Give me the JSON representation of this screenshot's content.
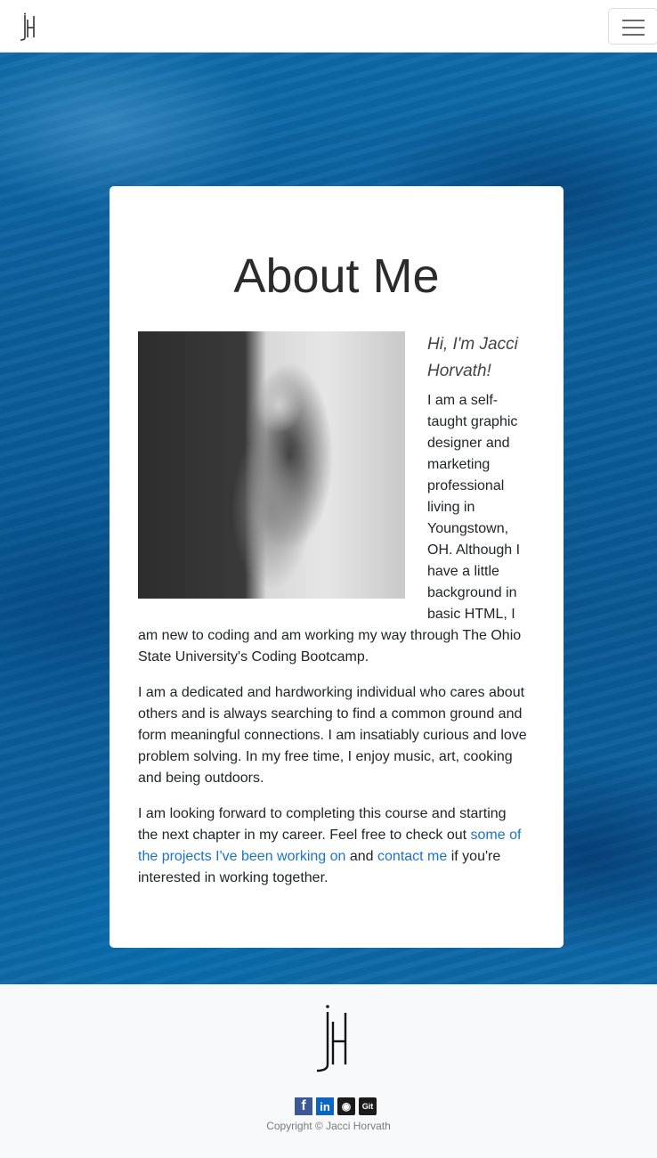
{
  "nav": {
    "logo_text": "jH",
    "menu_toggle_label": "Toggle navigation"
  },
  "about": {
    "title": "About Me",
    "greeting": "Hi, I'm Jacci Horvath!",
    "para1": "I am a self-taught graphic designer and marketing professional living in Youngstown, OH. Although I have a little background in basic HTML, I am new to coding and am working my way through The Ohio State University's Coding Bootcamp.",
    "para2": "I am a dedicated and hardworking individual who cares about others and is always searching to find a common ground and form meaningful connections. I am insatiably curious and love problem solving. In my free time, I enjoy music, art, cooking and being outdoors.",
    "para3_before": "I am looking forward to completing this course and starting the next chapter in my career. Feel free to check out ",
    "projects_link": "some of the projects I've been working on",
    "para3_middle": " and ",
    "contact_link": "contact me",
    "para3_after": " if you're interested in working together."
  },
  "footer": {
    "logo_text": "jH",
    "socials": [
      {
        "name": "facebook-icon",
        "glyph": "f"
      },
      {
        "name": "linkedin-icon",
        "glyph": "in"
      },
      {
        "name": "github-icon",
        "glyph": "◉"
      },
      {
        "name": "git-icon",
        "glyph": "Git"
      }
    ],
    "copyright": "Copyright © Jacci Horvath"
  },
  "colors": {
    "link": "#1a73c8",
    "hero_blue": "#0b5f9c",
    "card_bg": "#ffffff"
  }
}
